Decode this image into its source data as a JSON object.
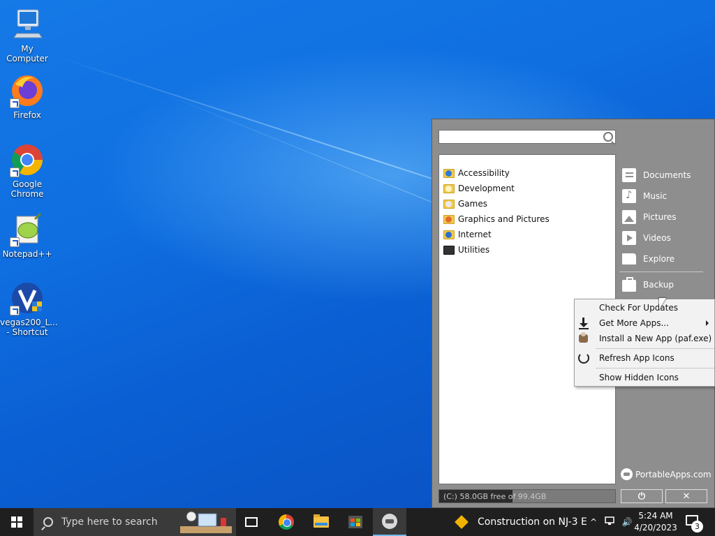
{
  "desktop": {
    "icons": [
      {
        "label": "My Computer",
        "icon": "computer-icon"
      },
      {
        "label": "Firefox",
        "icon": "firefox-icon"
      },
      {
        "label": "Google Chrome",
        "icon": "chrome-icon"
      },
      {
        "label": "Notepad++",
        "icon": "notepad-plus-plus-icon"
      },
      {
        "label": "vegas200_L... - Shortcut",
        "icon": "vegas-icon"
      }
    ]
  },
  "portableapps": {
    "search": {
      "value": "",
      "placeholder": ""
    },
    "categories": [
      {
        "label": "Accessibility",
        "badge": "#2e7bd6"
      },
      {
        "label": "Development",
        "badge": "#f2c94c"
      },
      {
        "label": "Games",
        "badge": "#eaeaea"
      },
      {
        "label": "Graphics and Pictures",
        "badge": "#e06c2c"
      },
      {
        "label": "Internet",
        "badge": "#2a6fcc"
      },
      {
        "label": "Utilities",
        "badge": "#333333"
      }
    ],
    "sidebar": {
      "documents": "Documents",
      "music": "Music",
      "pictures": "Pictures",
      "videos": "Videos",
      "explore": "Explore",
      "backup": "Backup"
    },
    "brand": "PortableApps.com",
    "drive_status": {
      "text": "(C:) 58.0GB free of 99.4GB",
      "used_fraction": 0.416
    },
    "power_glyph": "⏻",
    "close_glyph": "✕"
  },
  "context_menu": {
    "items": [
      {
        "label": "Check For Updates",
        "icon": "clock-icon"
      },
      {
        "label": "Get More Apps...",
        "icon": "download-icon"
      },
      {
        "label": "Install a New App (paf.exe)",
        "icon": "package-icon"
      },
      {
        "label": "Refresh App Icons",
        "icon": "refresh-icon"
      },
      {
        "label": "Show Hidden Icons",
        "icon": ""
      }
    ]
  },
  "taskbar": {
    "search_placeholder": "Type here to search",
    "news": "Construction on NJ-3 E",
    "time": "5:24 AM",
    "date": "4/20/2023",
    "notification_count": "3",
    "tray_chevron": "^",
    "volume_glyph": "🔊"
  },
  "colors": {
    "menu_bg": "#8e8e8e",
    "taskbar_bg": "#1f1f1f",
    "desktop_blue": "#0f6ee0"
  }
}
